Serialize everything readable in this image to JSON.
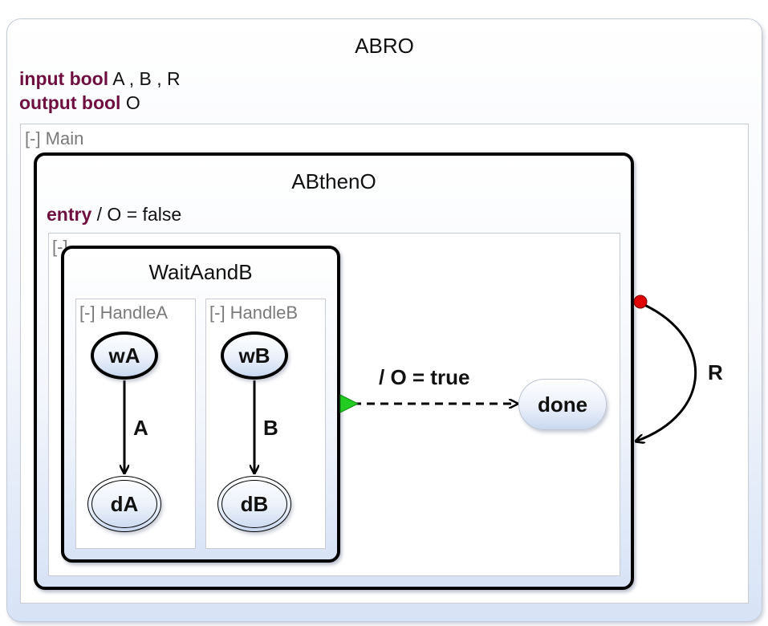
{
  "root": {
    "name": "ABRO",
    "decl_input_keyword": "input bool",
    "decl_input_vars": "A , B , R",
    "decl_output_keyword": "output bool",
    "decl_output_vars": "O",
    "region_label": "[-] Main"
  },
  "abthen": {
    "name": "ABthenO",
    "entry_keyword": "entry",
    "entry_action": "/ O = false",
    "region_label": "[-]"
  },
  "wait": {
    "name": "WaitAandB",
    "regions": [
      {
        "label": "[-] HandleA",
        "initial": "wA",
        "final": "dA",
        "trigger": "A"
      },
      {
        "label": "[-] HandleB",
        "initial": "wB",
        "final": "dB",
        "trigger": "B"
      }
    ]
  },
  "done_state": "done",
  "transitions": {
    "termination_label": "/ O = true",
    "reset_label": "R"
  },
  "colors": {
    "keyword": "#6e0f3f",
    "strong_abort_dot": "#e00000",
    "termination_marker": "#22cc22"
  }
}
